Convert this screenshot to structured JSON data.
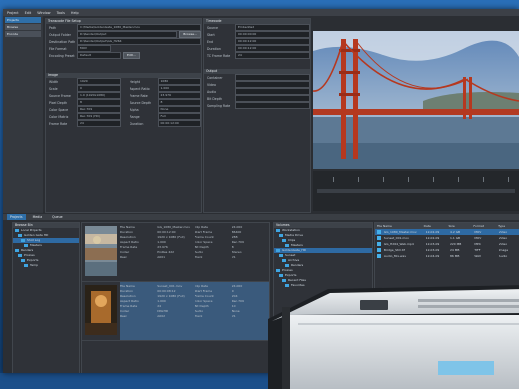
{
  "menu": [
    "Project",
    "Edit",
    "Window",
    "Tools",
    "Help"
  ],
  "left_rail": [
    "Projects",
    "Browse",
    "Encode"
  ],
  "transcode": {
    "section": "Transcode File Setup",
    "file_label": "Path",
    "file_value": "C:\\Media\\GoldenGate_1080_Master.mov",
    "browse_button": "Browse...",
    "output_label": "Output Folder",
    "output_value": "D:\\Render\\Output",
    "destination_label": "Destination Path",
    "destination_value": "D:\\Render\\Output\\GG_H264",
    "format_label": "File Format",
    "format_value": "MOV",
    "preset_label": "Encoding Preset",
    "preset_value": "Default",
    "preset_button": "Edit...",
    "image_section": "Image",
    "fields": [
      {
        "l": "Width",
        "v": "1920"
      },
      {
        "l": "Height",
        "v": "1080"
      },
      {
        "l": "Scale",
        "v": "0"
      },
      {
        "l": "Aspect Ratio",
        "v": "1.000"
      },
      {
        "l": "Source Frame",
        "v": "1.0 (1920x1080)"
      },
      {
        "l": "Frame Rate",
        "v": "23.976"
      },
      {
        "l": "Pixel Depth",
        "v": "8"
      },
      {
        "l": "Source Depth",
        "v": "8"
      },
      {
        "l": "Color Space",
        "v": "Rec.709"
      },
      {
        "l": "Alpha",
        "v": "None"
      },
      {
        "l": "Color Matrix",
        "v": "Rec.709 (HD)"
      },
      {
        "l": "Range",
        "v": "Full"
      },
      {
        "l": "Frame Rate",
        "v": "24"
      },
      {
        "l": "Duration",
        "v": "00:00:12:00"
      }
    ]
  },
  "timecode": {
    "section": "Timecode",
    "rows": [
      {
        "l": "Source",
        "v": "Embedded"
      },
      {
        "l": "Start",
        "v": "00:00:00:00"
      },
      {
        "l": "End",
        "v": "00:00:12:00"
      },
      {
        "l": "Duration",
        "v": "00:00:12:00"
      },
      {
        "l": "TC Frame Rate",
        "v": "24"
      }
    ],
    "extra_section": "Output",
    "extra": [
      {
        "l": "Container",
        "v": ""
      },
      {
        "l": "Video",
        "v": ""
      },
      {
        "l": "Audio",
        "v": ""
      },
      {
        "l": "Bit Depth",
        "v": ""
      },
      {
        "l": "Sampling Rate",
        "v": ""
      }
    ]
  },
  "bottom_tabs": [
    "Projects",
    "Media",
    "Queue"
  ],
  "tree_left": {
    "title": "Browse Bin",
    "nodes": [
      "Local Projects",
      "Golden Gate HD",
      "Shot Log",
      "Masters",
      "Renders",
      "Proxies",
      "Exports",
      "Temp"
    ]
  },
  "clip_meta": [
    [
      "File Name",
      "GG_1080_Master.mov",
      "Clip Rate",
      "24.000"
    ],
    [
      "Duration",
      "00:00:12:00",
      "Start Frame",
      "86400"
    ],
    [
      "Resolution",
      "1920 x 1080 (Full)",
      "Frame Count",
      "288"
    ],
    [
      "Aspect Ratio",
      "1.000",
      "Color Space",
      "Rec.709"
    ],
    [
      "Frame Rate",
      "23.976",
      "Bit Depth",
      "8"
    ],
    [
      "Codec",
      "ProRes 422",
      "Audio",
      "Stereo"
    ],
    [
      "Reel",
      "A001",
      "Track",
      "V1"
    ]
  ],
  "clip_meta2": [
    [
      "File Name",
      "Sunset_001.mov",
      "Clip Rate",
      "24.000"
    ],
    [
      "Duration",
      "00:00:08:12",
      "Start Frame",
      "0"
    ],
    [
      "Resolution",
      "1920 x 1080 (Full)",
      "Frame Count",
      "204"
    ],
    [
      "Aspect Ratio",
      "1.000",
      "Color Space",
      "Rec.709"
    ],
    [
      "Frame Rate",
      "24",
      "Bit Depth",
      "10"
    ],
    [
      "Codec",
      "DNxHD",
      "Audio",
      "None"
    ],
    [
      "Reel",
      "A002",
      "Track",
      "V1"
    ]
  ],
  "tree_mid": {
    "title": "Volumes",
    "nodes": [
      "Workstation",
      "Media Drive",
      "Clips",
      "Masters",
      "GoldenGate_HD",
      "Sunset",
      "Archive",
      "Renders",
      "Proxies",
      "Exports",
      "Recent Files",
      "Favorites"
    ]
  },
  "file_list": {
    "headers": [
      "File Name",
      "Date",
      "Size",
      "Format",
      "Type"
    ],
    "rows": [
      [
        "GG_1080_Master.mov",
        "12-02-09",
        "4.2 GB",
        "MOV",
        "Video"
      ],
      [
        "Sunset_001.mov",
        "12-02-09",
        "1.1 GB",
        "MOV",
        "Video"
      ],
      [
        "GG_H264_Web.mp4",
        "12-03-09",
        "220 MB",
        "MP4",
        "Video"
      ],
      [
        "Bridge_Still.tif",
        "12-03-09",
        "24 MB",
        "TIFF",
        "Image"
      ],
      [
        "Audio_Mix.wav",
        "12-04-09",
        "86 MB",
        "WAV",
        "Audio"
      ]
    ]
  },
  "colors": {
    "accent": "#2f6fa8",
    "panel": "#2f3238",
    "folder": "#3fa4e0"
  }
}
